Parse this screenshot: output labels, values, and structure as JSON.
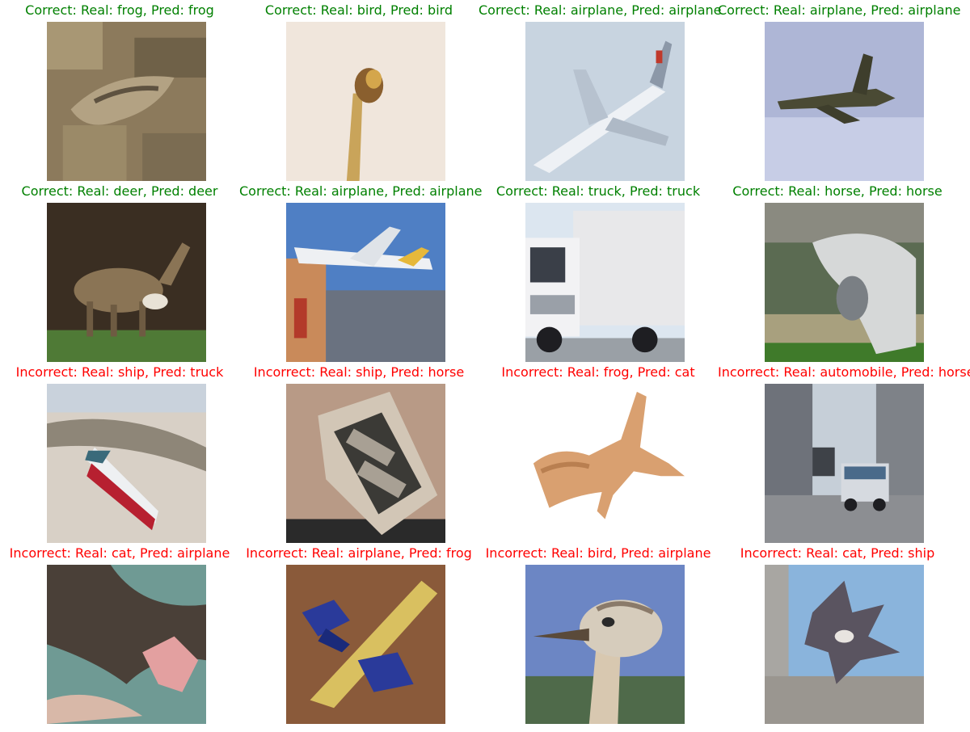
{
  "colors": {
    "correct": "#008000",
    "incorrect": "#ff0000"
  },
  "results": [
    {
      "label": "Correct: Real: frog, Pred: frog",
      "correct": true,
      "icon": "frog-thumbnail"
    },
    {
      "label": "Correct: Real: bird, Pred: bird",
      "correct": true,
      "icon": "bird-thumbnail"
    },
    {
      "label": "Correct: Real: airplane, Pred: airplane",
      "correct": true,
      "icon": "airplane-thumbnail"
    },
    {
      "label": "Correct: Real: airplane, Pred: airplane",
      "correct": true,
      "icon": "airplane-thumbnail"
    },
    {
      "label": "Correct: Real: deer, Pred: deer",
      "correct": true,
      "icon": "deer-thumbnail"
    },
    {
      "label": "Correct: Real: airplane, Pred: airplane",
      "correct": true,
      "icon": "airplane-thumbnail"
    },
    {
      "label": "Correct: Real: truck, Pred: truck",
      "correct": true,
      "icon": "truck-thumbnail"
    },
    {
      "label": "Correct: Real: horse, Pred: horse",
      "correct": true,
      "icon": "horse-thumbnail"
    },
    {
      "label": "Incorrect: Real: ship, Pred: truck",
      "correct": false,
      "icon": "ship-thumbnail"
    },
    {
      "label": "Incorrect: Real: ship, Pred: horse",
      "correct": false,
      "icon": "ship-thumbnail"
    },
    {
      "label": "Incorrect: Real: frog, Pred: cat",
      "correct": false,
      "icon": "frog-thumbnail"
    },
    {
      "label": "Incorrect: Real: automobile, Pred: horse",
      "correct": false,
      "icon": "automobile-thumbnail"
    },
    {
      "label": "Incorrect: Real: cat, Pred: airplane",
      "correct": false,
      "icon": "cat-thumbnail"
    },
    {
      "label": "Incorrect: Real: airplane, Pred: frog",
      "correct": false,
      "icon": "airplane-thumbnail"
    },
    {
      "label": "Incorrect: Real: bird, Pred: airplane",
      "correct": false,
      "icon": "bird-thumbnail"
    },
    {
      "label": "Incorrect: Real: cat, Pred: ship",
      "correct": false,
      "icon": "cat-thumbnail"
    }
  ]
}
